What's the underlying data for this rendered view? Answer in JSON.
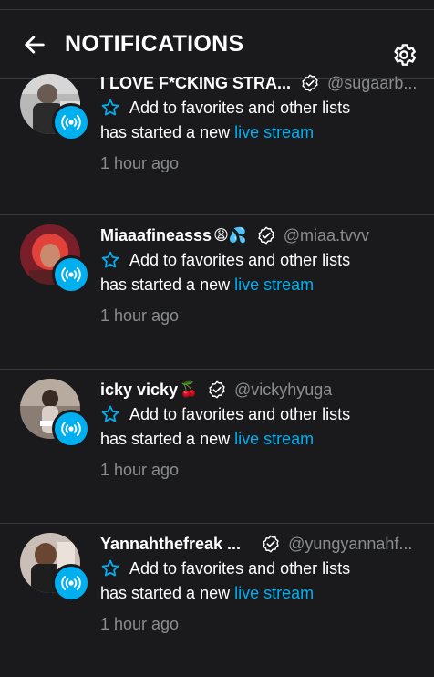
{
  "header": {
    "title": "NOTIFICATIONS",
    "back_icon": "arrow-left-icon",
    "settings_icon": "gear-icon"
  },
  "colors": {
    "background": "#1a1a1c",
    "accent": "#00aff0",
    "muted": "#8a8c91",
    "divider": "#3a3a3c"
  },
  "notifications": [
    {
      "name": "I LOVE F*CKING STRA...",
      "emoji": "",
      "handle": "@sugaarb...",
      "favorites_label": "Add to favorites and other lists",
      "message_prefix": "has started a new ",
      "message_link": "live stream",
      "time": "1 hour ago"
    },
    {
      "name": "Miaaafineasss",
      "emoji": "😩💦",
      "handle": "@miaa.tvvv",
      "favorites_label": "Add to favorites and other lists",
      "message_prefix": "has started a new ",
      "message_link": "live stream",
      "time": "1 hour ago"
    },
    {
      "name": "icky vicky",
      "emoji": "🍒",
      "handle": "@vickyhyuga",
      "favorites_label": "Add to favorites and other lists",
      "message_prefix": "has started a new ",
      "message_link": "live stream",
      "time": "1 hour ago"
    },
    {
      "name": "Yannahthefreak ...",
      "emoji": "",
      "handle": "@yungyannahf...",
      "favorites_label": "Add to favorites and other lists",
      "message_prefix": "has started a new ",
      "message_link": "live stream",
      "time": "1 hour ago"
    }
  ]
}
